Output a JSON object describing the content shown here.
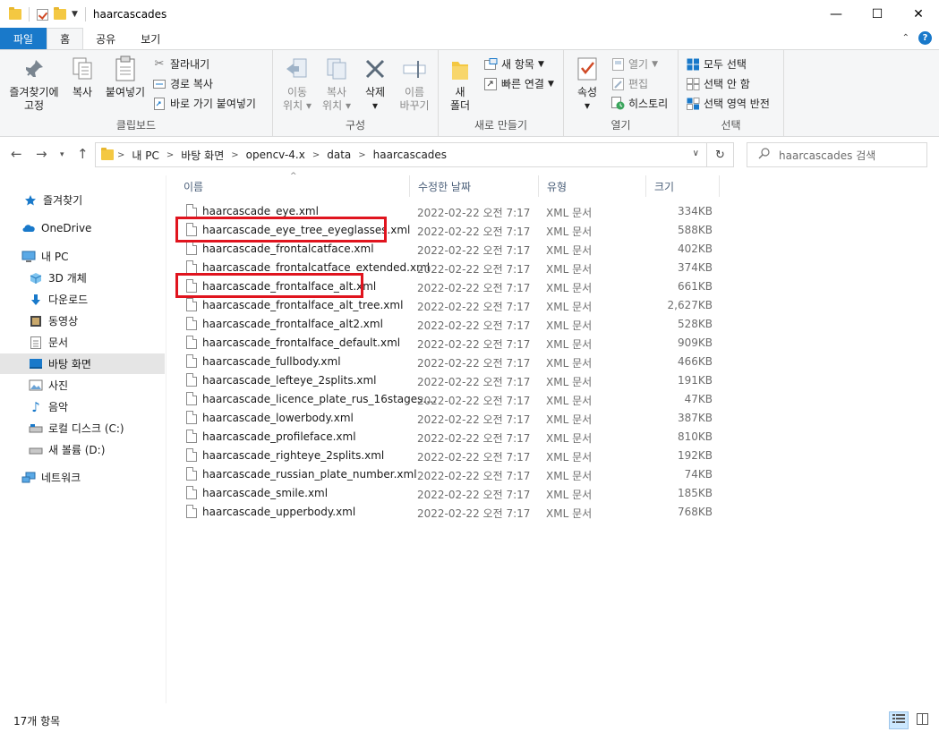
{
  "window": {
    "title": "haarcascades",
    "minimize": "—",
    "maximize": "☐",
    "close": "✕"
  },
  "tabs": [
    {
      "label": "파일"
    },
    {
      "label": "홈"
    },
    {
      "label": "공유"
    },
    {
      "label": "보기"
    }
  ],
  "ribbon": {
    "clipboard": {
      "pin_label_line1": "즐겨찾기에",
      "pin_label_line2": "고정",
      "copy_label": "복사",
      "paste_label": "붙여넣기",
      "cut_label": "잘라내기",
      "copy_path_label": "경로 복사",
      "paste_shortcut_label": "바로 가기 붙여넣기",
      "group_label": "클립보드"
    },
    "organize": {
      "move_label_line1": "이동",
      "move_label_line2": "위치",
      "copyto_label_line1": "복사",
      "copyto_label_line2": "위치",
      "delete_label": "삭제",
      "rename_label_line1": "이름",
      "rename_label_line2": "바꾸기",
      "group_label": "구성"
    },
    "new": {
      "new_folder_line1": "새",
      "new_folder_line2": "폴더",
      "new_item_label": "새 항목",
      "easy_access_label": "빠른 연결",
      "group_label": "새로 만들기"
    },
    "open": {
      "properties_label": "속성",
      "open_label": "열기",
      "edit_label": "편집",
      "history_label": "히스토리",
      "group_label": "열기"
    },
    "select": {
      "select_all_label": "모두 선택",
      "select_none_label": "선택 안 함",
      "invert_label": "선택 영역 반전",
      "group_label": "선택"
    }
  },
  "address": {
    "crumbs": [
      "내 PC",
      "바탕 화면",
      "opencv-4.x",
      "data",
      "haarcascades"
    ],
    "search_placeholder": "haarcascades 검색"
  },
  "sidebar": {
    "items": [
      {
        "label": "즐겨찾기",
        "icon": "star-icon"
      },
      {
        "label": "OneDrive",
        "icon": "cloud-icon"
      },
      {
        "label": "내 PC",
        "icon": "pc-icon"
      },
      {
        "label": "3D 개체",
        "icon": "cube-icon"
      },
      {
        "label": "다운로드",
        "icon": "download-icon"
      },
      {
        "label": "동영상",
        "icon": "video-icon"
      },
      {
        "label": "문서",
        "icon": "document-icon"
      },
      {
        "label": "바탕 화면",
        "icon": "desktop-icon"
      },
      {
        "label": "사진",
        "icon": "pictures-icon"
      },
      {
        "label": "음악",
        "icon": "music-icon"
      },
      {
        "label": "로컬 디스크 (C:)",
        "icon": "drive-icon"
      },
      {
        "label": "새 볼륨 (D:)",
        "icon": "drive-icon"
      },
      {
        "label": "네트워크",
        "icon": "network-icon"
      }
    ]
  },
  "columns": {
    "name": "이름",
    "modified": "수정한 날짜",
    "type": "유형",
    "size": "크기"
  },
  "files": [
    {
      "name": "haarcascade_eye.xml",
      "date": "2022-02-22 오전 7:17",
      "type": "XML 문서",
      "size": "334KB"
    },
    {
      "name": "haarcascade_eye_tree_eyeglasses.xml",
      "date": "2022-02-22 오전 7:17",
      "type": "XML 문서",
      "size": "588KB"
    },
    {
      "name": "haarcascade_frontalcatface.xml",
      "date": "2022-02-22 오전 7:17",
      "type": "XML 문서",
      "size": "402KB"
    },
    {
      "name": "haarcascade_frontalcatface_extended.xml",
      "date": "2022-02-22 오전 7:17",
      "type": "XML 문서",
      "size": "374KB"
    },
    {
      "name": "haarcascade_frontalface_alt.xml",
      "date": "2022-02-22 오전 7:17",
      "type": "XML 문서",
      "size": "661KB"
    },
    {
      "name": "haarcascade_frontalface_alt_tree.xml",
      "date": "2022-02-22 오전 7:17",
      "type": "XML 문서",
      "size": "2,627KB"
    },
    {
      "name": "haarcascade_frontalface_alt2.xml",
      "date": "2022-02-22 오전 7:17",
      "type": "XML 문서",
      "size": "528KB"
    },
    {
      "name": "haarcascade_frontalface_default.xml",
      "date": "2022-02-22 오전 7:17",
      "type": "XML 문서",
      "size": "909KB"
    },
    {
      "name": "haarcascade_fullbody.xml",
      "date": "2022-02-22 오전 7:17",
      "type": "XML 문서",
      "size": "466KB"
    },
    {
      "name": "haarcascade_lefteye_2splits.xml",
      "date": "2022-02-22 오전 7:17",
      "type": "XML 문서",
      "size": "191KB"
    },
    {
      "name": "haarcascade_licence_plate_rus_16stages....",
      "date": "2022-02-22 오전 7:17",
      "type": "XML 문서",
      "size": "47KB"
    },
    {
      "name": "haarcascade_lowerbody.xml",
      "date": "2022-02-22 오전 7:17",
      "type": "XML 문서",
      "size": "387KB"
    },
    {
      "name": "haarcascade_profileface.xml",
      "date": "2022-02-22 오전 7:17",
      "type": "XML 문서",
      "size": "810KB"
    },
    {
      "name": "haarcascade_righteye_2splits.xml",
      "date": "2022-02-22 오전 7:17",
      "type": "XML 문서",
      "size": "192KB"
    },
    {
      "name": "haarcascade_russian_plate_number.xml",
      "date": "2022-02-22 오전 7:17",
      "type": "XML 문서",
      "size": "74KB"
    },
    {
      "name": "haarcascade_smile.xml",
      "date": "2022-02-22 오전 7:17",
      "type": "XML 문서",
      "size": "185KB"
    },
    {
      "name": "haarcascade_upperbody.xml",
      "date": "2022-02-22 오전 7:17",
      "type": "XML 문서",
      "size": "768KB"
    }
  ],
  "status": {
    "count": "17개 항목"
  },
  "colors": {
    "accent": "#1979ca",
    "highlight": "#e0141e",
    "folder": "#f4c842"
  }
}
